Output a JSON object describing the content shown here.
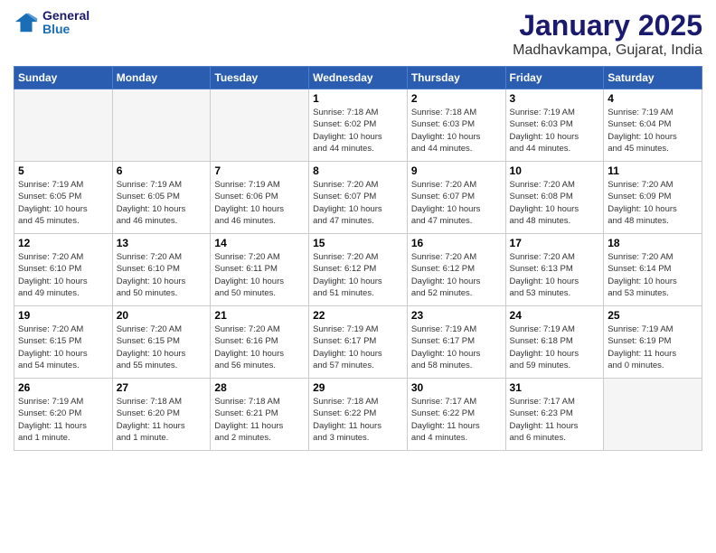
{
  "logo": {
    "line1": "General",
    "line2": "Blue"
  },
  "title": "January 2025",
  "subtitle": "Madhavkampa, Gujarat, India",
  "weekdays": [
    "Sunday",
    "Monday",
    "Tuesday",
    "Wednesday",
    "Thursday",
    "Friday",
    "Saturday"
  ],
  "weeks": [
    [
      {
        "day": "",
        "info": ""
      },
      {
        "day": "",
        "info": ""
      },
      {
        "day": "",
        "info": ""
      },
      {
        "day": "1",
        "info": "Sunrise: 7:18 AM\nSunset: 6:02 PM\nDaylight: 10 hours\nand 44 minutes."
      },
      {
        "day": "2",
        "info": "Sunrise: 7:18 AM\nSunset: 6:03 PM\nDaylight: 10 hours\nand 44 minutes."
      },
      {
        "day": "3",
        "info": "Sunrise: 7:19 AM\nSunset: 6:03 PM\nDaylight: 10 hours\nand 44 minutes."
      },
      {
        "day": "4",
        "info": "Sunrise: 7:19 AM\nSunset: 6:04 PM\nDaylight: 10 hours\nand 45 minutes."
      }
    ],
    [
      {
        "day": "5",
        "info": "Sunrise: 7:19 AM\nSunset: 6:05 PM\nDaylight: 10 hours\nand 45 minutes."
      },
      {
        "day": "6",
        "info": "Sunrise: 7:19 AM\nSunset: 6:05 PM\nDaylight: 10 hours\nand 46 minutes."
      },
      {
        "day": "7",
        "info": "Sunrise: 7:19 AM\nSunset: 6:06 PM\nDaylight: 10 hours\nand 46 minutes."
      },
      {
        "day": "8",
        "info": "Sunrise: 7:20 AM\nSunset: 6:07 PM\nDaylight: 10 hours\nand 47 minutes."
      },
      {
        "day": "9",
        "info": "Sunrise: 7:20 AM\nSunset: 6:07 PM\nDaylight: 10 hours\nand 47 minutes."
      },
      {
        "day": "10",
        "info": "Sunrise: 7:20 AM\nSunset: 6:08 PM\nDaylight: 10 hours\nand 48 minutes."
      },
      {
        "day": "11",
        "info": "Sunrise: 7:20 AM\nSunset: 6:09 PM\nDaylight: 10 hours\nand 48 minutes."
      }
    ],
    [
      {
        "day": "12",
        "info": "Sunrise: 7:20 AM\nSunset: 6:10 PM\nDaylight: 10 hours\nand 49 minutes."
      },
      {
        "day": "13",
        "info": "Sunrise: 7:20 AM\nSunset: 6:10 PM\nDaylight: 10 hours\nand 50 minutes."
      },
      {
        "day": "14",
        "info": "Sunrise: 7:20 AM\nSunset: 6:11 PM\nDaylight: 10 hours\nand 50 minutes."
      },
      {
        "day": "15",
        "info": "Sunrise: 7:20 AM\nSunset: 6:12 PM\nDaylight: 10 hours\nand 51 minutes."
      },
      {
        "day": "16",
        "info": "Sunrise: 7:20 AM\nSunset: 6:12 PM\nDaylight: 10 hours\nand 52 minutes."
      },
      {
        "day": "17",
        "info": "Sunrise: 7:20 AM\nSunset: 6:13 PM\nDaylight: 10 hours\nand 53 minutes."
      },
      {
        "day": "18",
        "info": "Sunrise: 7:20 AM\nSunset: 6:14 PM\nDaylight: 10 hours\nand 53 minutes."
      }
    ],
    [
      {
        "day": "19",
        "info": "Sunrise: 7:20 AM\nSunset: 6:15 PM\nDaylight: 10 hours\nand 54 minutes."
      },
      {
        "day": "20",
        "info": "Sunrise: 7:20 AM\nSunset: 6:15 PM\nDaylight: 10 hours\nand 55 minutes."
      },
      {
        "day": "21",
        "info": "Sunrise: 7:20 AM\nSunset: 6:16 PM\nDaylight: 10 hours\nand 56 minutes."
      },
      {
        "day": "22",
        "info": "Sunrise: 7:19 AM\nSunset: 6:17 PM\nDaylight: 10 hours\nand 57 minutes."
      },
      {
        "day": "23",
        "info": "Sunrise: 7:19 AM\nSunset: 6:17 PM\nDaylight: 10 hours\nand 58 minutes."
      },
      {
        "day": "24",
        "info": "Sunrise: 7:19 AM\nSunset: 6:18 PM\nDaylight: 10 hours\nand 59 minutes."
      },
      {
        "day": "25",
        "info": "Sunrise: 7:19 AM\nSunset: 6:19 PM\nDaylight: 11 hours\nand 0 minutes."
      }
    ],
    [
      {
        "day": "26",
        "info": "Sunrise: 7:19 AM\nSunset: 6:20 PM\nDaylight: 11 hours\nand 1 minute."
      },
      {
        "day": "27",
        "info": "Sunrise: 7:18 AM\nSunset: 6:20 PM\nDaylight: 11 hours\nand 1 minute."
      },
      {
        "day": "28",
        "info": "Sunrise: 7:18 AM\nSunset: 6:21 PM\nDaylight: 11 hours\nand 2 minutes."
      },
      {
        "day": "29",
        "info": "Sunrise: 7:18 AM\nSunset: 6:22 PM\nDaylight: 11 hours\nand 3 minutes."
      },
      {
        "day": "30",
        "info": "Sunrise: 7:17 AM\nSunset: 6:22 PM\nDaylight: 11 hours\nand 4 minutes."
      },
      {
        "day": "31",
        "info": "Sunrise: 7:17 AM\nSunset: 6:23 PM\nDaylight: 11 hours\nand 6 minutes."
      },
      {
        "day": "",
        "info": ""
      }
    ]
  ]
}
